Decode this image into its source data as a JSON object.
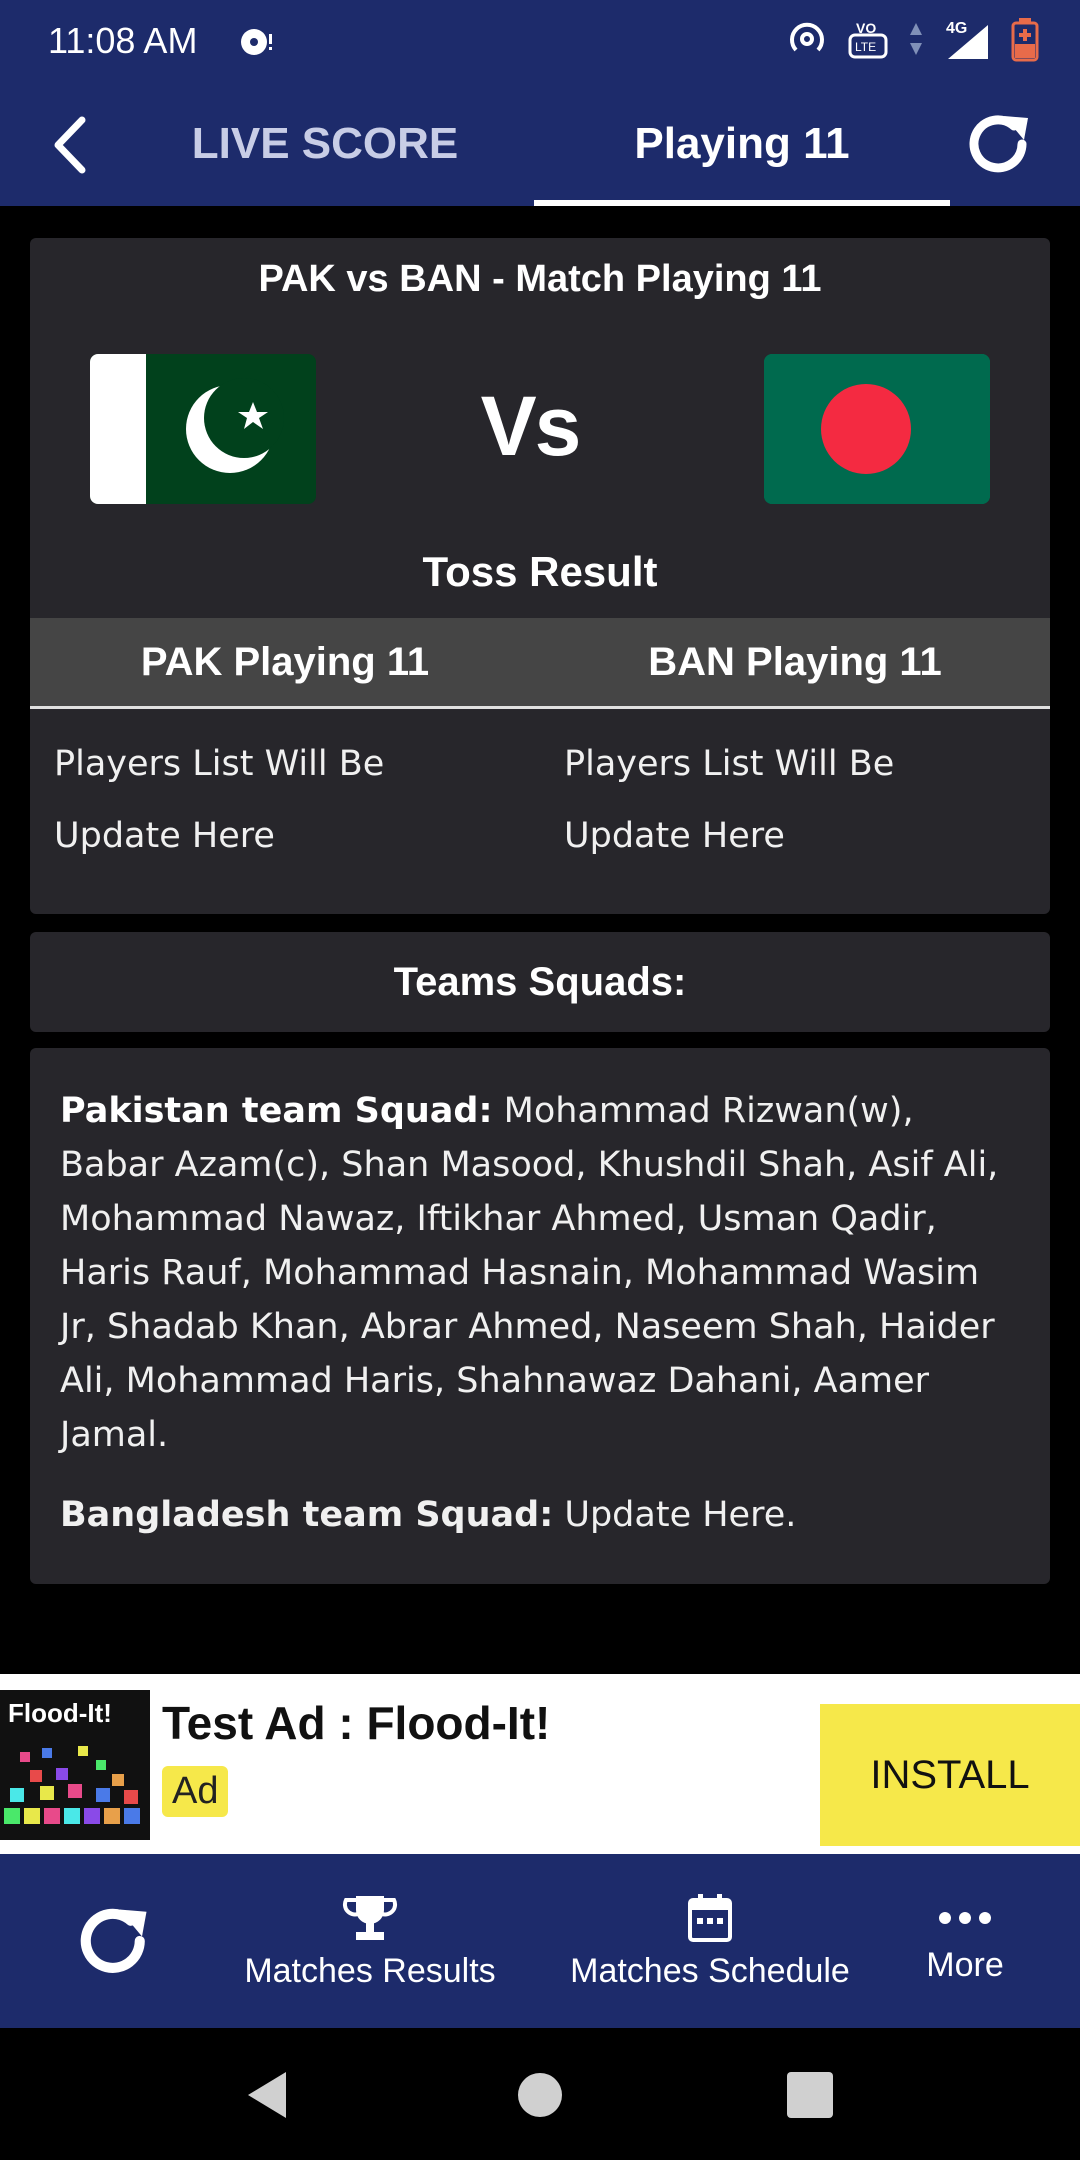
{
  "status_bar": {
    "time": "11:08 AM",
    "network": "4G",
    "volte": "VO LTE"
  },
  "app_bar": {
    "tabs": [
      {
        "label": "LIVE SCORE",
        "selected": false
      },
      {
        "label": "Playing 11",
        "selected": true
      }
    ]
  },
  "match": {
    "title": "PAK vs BAN - Match Playing 11",
    "vs_label": "Vs",
    "toss_label": "Toss Result",
    "team1": {
      "playing_header": "PAK Playing 11",
      "players_text": "Players List Will Be Update Here"
    },
    "team2": {
      "playing_header": "BAN Playing 11",
      "players_text": "Players List Will Be Update Here"
    }
  },
  "squads": {
    "heading": "Teams Squads:",
    "pakistan_label": "Pakistan team Squad:",
    "pakistan_players": "Mohammad Rizwan(w), Babar Azam(c), Shan Masood, Khushdil Shah, Asif Ali, Mohammad Nawaz, Iftikhar Ahmed, Usman Qadir, Haris Rauf, Mohammad Hasnain, Mohammad Wasim Jr, Shadab Khan, Abrar Ahmed, Naseem Shah, Haider Ali, Mohammad Haris, Shahnawaz Dahani, Aamer Jamal.",
    "bangladesh_label": "Bangladesh team Squad:",
    "bangladesh_players": "Update Here."
  },
  "ad": {
    "thumb_title": "Flood-It!",
    "title": "Test Ad : Flood-It!",
    "badge": "Ad",
    "install_label": "INSTALL"
  },
  "bottom_nav": {
    "results_label": "Matches Results",
    "schedule_label": "Matches Schedule",
    "more_label": "More"
  },
  "colors": {
    "app_bar": "#1d2b6b",
    "card": "#27262b",
    "header_row": "#454545",
    "ad_yellow": "#f6e84a",
    "pak_green": "#01411c",
    "ban_green": "#006a4e",
    "ban_red": "#f42a41"
  }
}
